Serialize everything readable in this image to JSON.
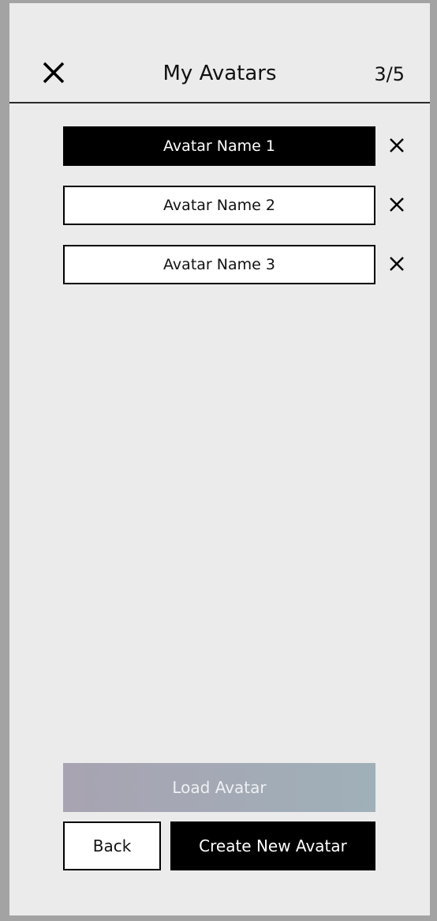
{
  "header": {
    "title": "My Avatars",
    "counter": "3/5"
  },
  "avatars": [
    {
      "name": "Avatar Name 1",
      "selected": true
    },
    {
      "name": "Avatar Name 2",
      "selected": false
    },
    {
      "name": "Avatar Name 3",
      "selected": false
    }
  ],
  "actions": {
    "load_label": "Load Avatar",
    "back_label": "Back",
    "create_label": "Create New Avatar"
  },
  "colors": {
    "background": "#ebebeb",
    "frame": "#a3a3a3",
    "selected": "#000000",
    "load_gradient_start": "#a8a3b2",
    "load_gradient_end": "#9fb0b8"
  },
  "icons": {
    "close": "close-icon",
    "remove": "remove-icon"
  }
}
